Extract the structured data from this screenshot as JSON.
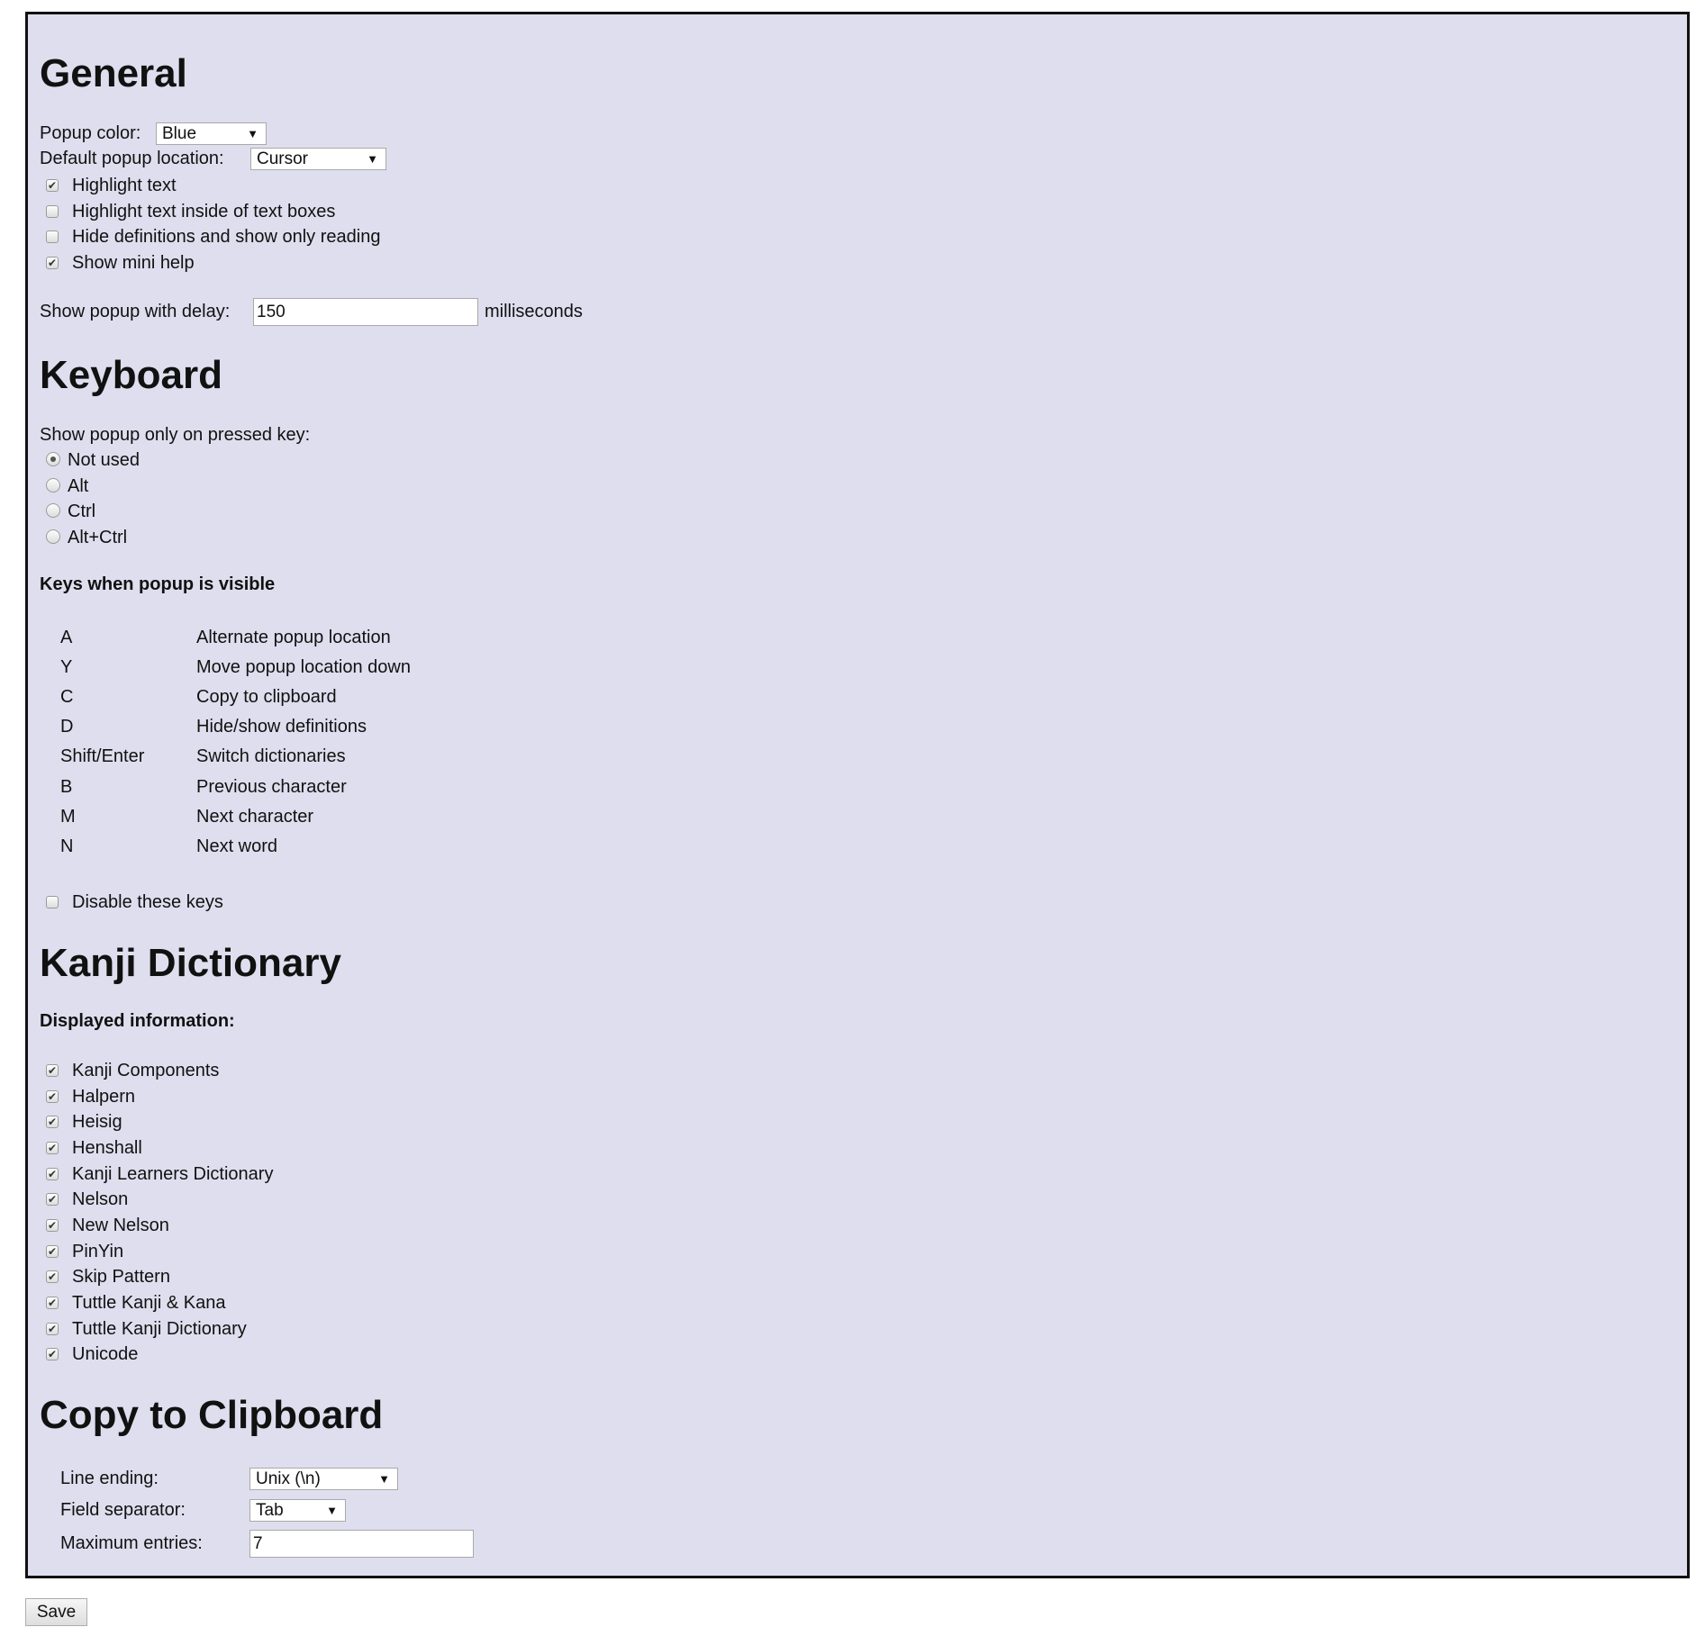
{
  "general": {
    "title": "General",
    "popup_color_label": "Popup color:",
    "popup_color_value": "Blue",
    "popup_location_label": "Default popup location:",
    "popup_location_value": "Cursor",
    "checkboxes": [
      {
        "label": "Highlight text",
        "checked": true
      },
      {
        "label": "Highlight text inside of text boxes",
        "checked": false
      },
      {
        "label": "Hide definitions and show only reading",
        "checked": false
      },
      {
        "label": "Show mini help",
        "checked": true
      }
    ],
    "delay_label": "Show popup with delay:",
    "delay_value": "150",
    "delay_unit": "milliseconds"
  },
  "keyboard": {
    "title": "Keyboard",
    "pressed_key_label": "Show popup only on pressed key:",
    "radios": [
      {
        "label": "Not used",
        "selected": true
      },
      {
        "label": "Alt",
        "selected": false
      },
      {
        "label": "Ctrl",
        "selected": false
      },
      {
        "label": "Alt+Ctrl",
        "selected": false
      }
    ],
    "keys_heading": "Keys when popup is visible",
    "keys": [
      {
        "key": "A",
        "action": "Alternate popup location"
      },
      {
        "key": "Y",
        "action": "Move popup location down"
      },
      {
        "key": "C",
        "action": "Copy to clipboard"
      },
      {
        "key": "D",
        "action": "Hide/show definitions"
      },
      {
        "key": "Shift/Enter",
        "action": "Switch dictionaries"
      },
      {
        "key": "B",
        "action": "Previous character"
      },
      {
        "key": "M",
        "action": "Next character"
      },
      {
        "key": "N",
        "action": "Next word"
      }
    ],
    "disable_keys_label": "Disable these keys",
    "disable_keys_checked": false
  },
  "kanji": {
    "title": "Kanji Dictionary",
    "displayed_heading": "Displayed information:",
    "items": [
      {
        "label": "Kanji Components",
        "checked": true
      },
      {
        "label": "Halpern",
        "checked": true
      },
      {
        "label": "Heisig",
        "checked": true
      },
      {
        "label": "Henshall",
        "checked": true
      },
      {
        "label": "Kanji Learners Dictionary",
        "checked": true
      },
      {
        "label": "Nelson",
        "checked": true
      },
      {
        "label": "New Nelson",
        "checked": true
      },
      {
        "label": "PinYin",
        "checked": true
      },
      {
        "label": "Skip Pattern",
        "checked": true
      },
      {
        "label": "Tuttle Kanji & Kana",
        "checked": true
      },
      {
        "label": "Tuttle Kanji Dictionary",
        "checked": true
      },
      {
        "label": "Unicode",
        "checked": true
      }
    ]
  },
  "clipboard": {
    "title": "Copy to Clipboard",
    "line_ending_label": "Line ending:",
    "line_ending_value": "Unix (\\n)",
    "field_separator_label": "Field separator:",
    "field_separator_value": "Tab",
    "max_entries_label": "Maximum entries:",
    "max_entries_value": "7"
  },
  "save_label": "Save",
  "colors": {
    "panel_bg": "#dfdeee",
    "border": "#111111"
  }
}
